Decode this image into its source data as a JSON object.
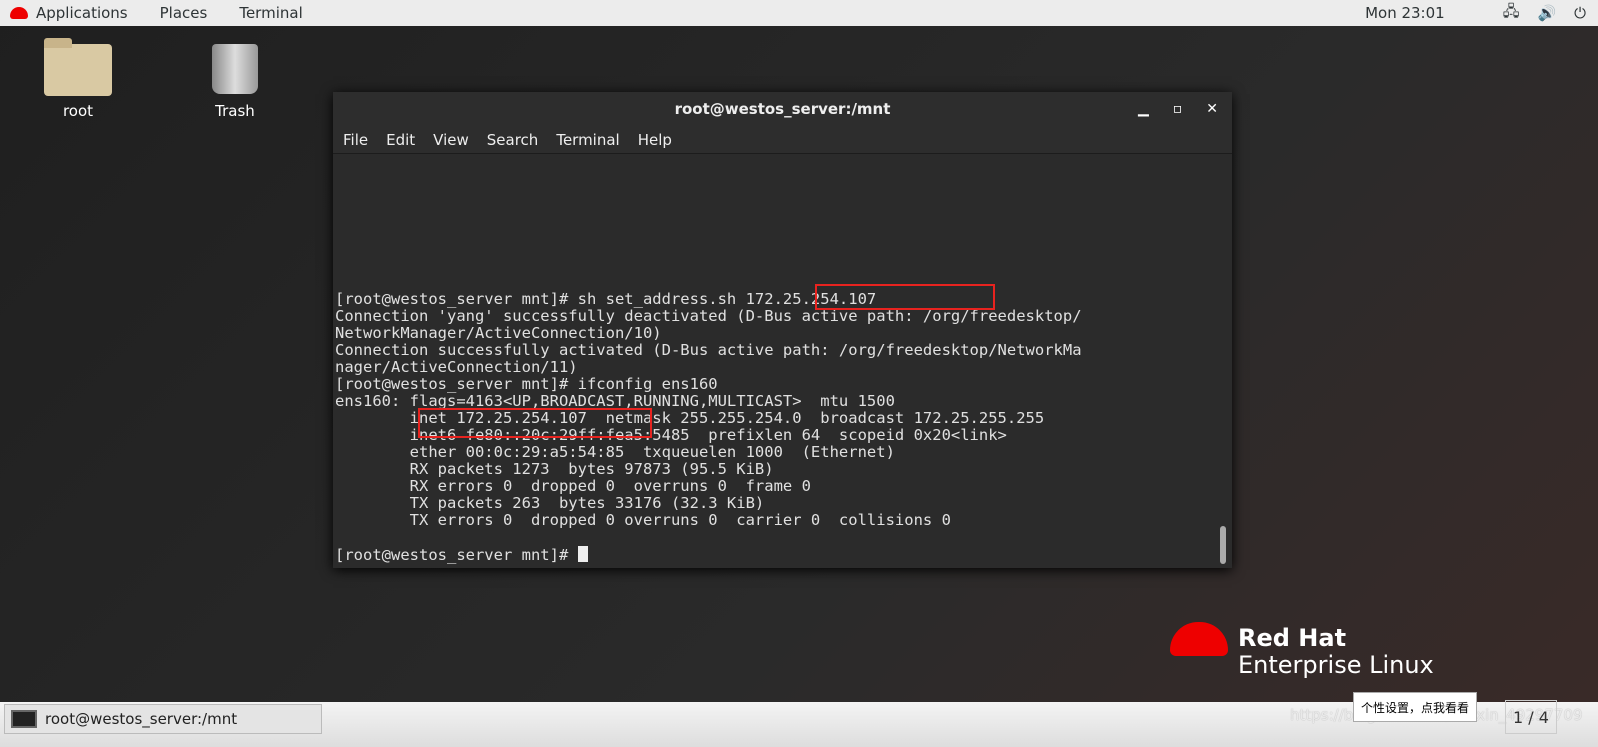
{
  "topbar": {
    "applications": "Applications",
    "places": "Places",
    "terminal": "Terminal",
    "clock": "Mon 23:01",
    "network_icon": "network-icon",
    "volume_icon": "volume-icon",
    "power_icon": "power-icon"
  },
  "desktop": {
    "icons": [
      {
        "label": "root",
        "icon": "home-folder-icon"
      },
      {
        "label": "Trash",
        "icon": "trash-icon"
      }
    ]
  },
  "window": {
    "title": "root@westos_server:/mnt",
    "menu": [
      "File",
      "Edit",
      "View",
      "Search",
      "Terminal",
      "Help"
    ],
    "lines": [
      "[root@westos_server mnt]# sh set_address.sh 172.25.254.107",
      "Connection 'yang' successfully deactivated (D-Bus active path: /org/freedesktop/",
      "NetworkManager/ActiveConnection/10)",
      "Connection successfully activated (D-Bus active path: /org/freedesktop/NetworkMa",
      "nager/ActiveConnection/11)",
      "[root@westos_server mnt]# ifconfig ens160",
      "ens160: flags=4163<UP,BROADCAST,RUNNING,MULTICAST>  mtu 1500",
      "        inet 172.25.254.107  netmask 255.255.254.0  broadcast 172.25.255.255",
      "        inet6 fe80::20c:29ff:fea5:5485  prefixlen 64  scopeid 0x20<link>",
      "        ether 00:0c:29:a5:54:85  txqueuelen 1000  (Ethernet)",
      "        RX packets 1273  bytes 97873 (95.5 KiB)",
      "        RX errors 0  dropped 0  overruns 0  frame 0",
      "        TX packets 263  bytes 33176 (32.3 KiB)",
      "        TX errors 0  dropped 0 overruns 0  carrier 0  collisions 0",
      "",
      "[root@westos_server mnt]# "
    ]
  },
  "brand": {
    "line1": "Red Hat",
    "line2": "Enterprise Linux"
  },
  "taskbar": {
    "task": "root@westos_server:/mnt",
    "tooltip": "个性设置，点我看看",
    "watermark": "https://blog.csdn.net/weixin_49297709",
    "pager": "1 / 4"
  },
  "colors": {
    "highlight": "#e8231f",
    "brand_red": "#ee0000"
  }
}
